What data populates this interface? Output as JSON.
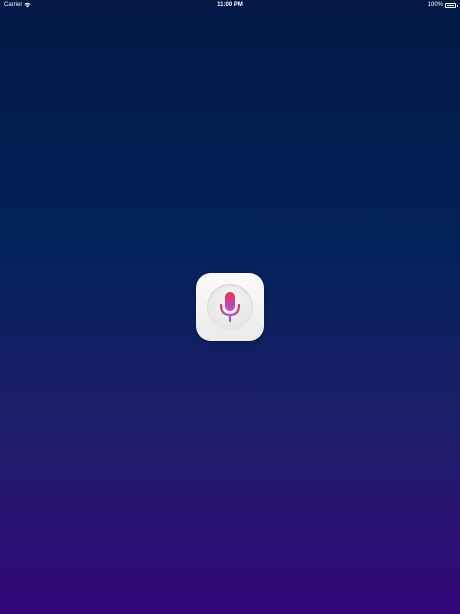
{
  "status_bar": {
    "carrier": "Carrier",
    "wifi_icon": "wifi-icon",
    "time": "11:00 PM",
    "battery_text": "100%",
    "battery_level": 1.0,
    "battery_icon": "battery-icon"
  },
  "app_icon": {
    "icon": "microphone-icon",
    "colors": {
      "mic_top": "#e8334f",
      "mic_bottom": "#b04fd0",
      "tile_background": "#f5f5f5",
      "background_top": "#031845",
      "background_bottom": "#33077a"
    }
  }
}
